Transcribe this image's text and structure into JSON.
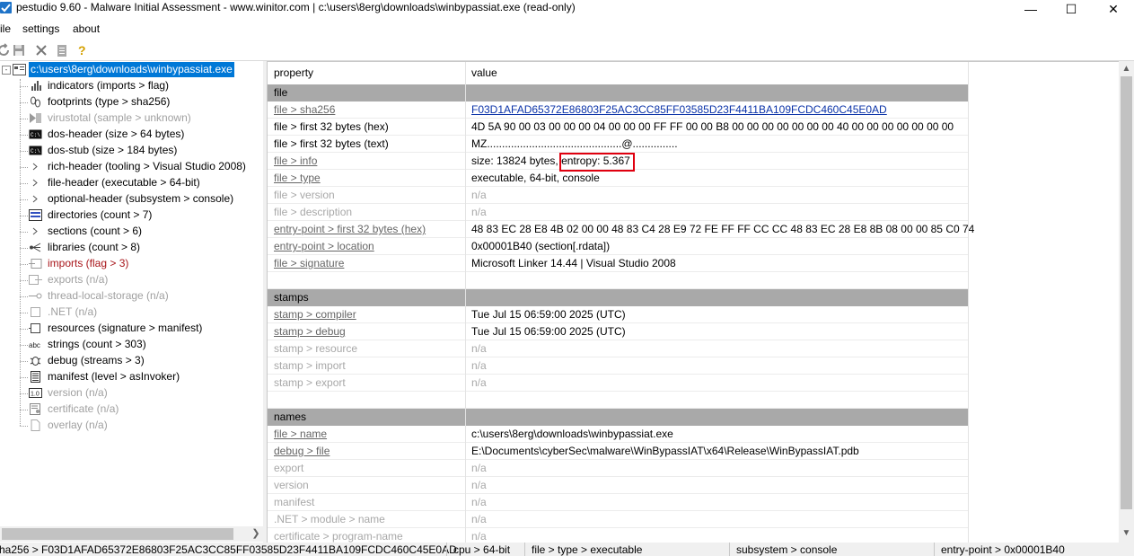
{
  "window": {
    "title": "pestudio 9.60 - Malware Initial Assessment - www.winitor.com | c:\\users\\8erg\\downloads\\winbypassiat.exe (read-only)",
    "minimize": "—",
    "maximize": "☐",
    "close": "✕"
  },
  "menu": {
    "file": "ile",
    "settings": "settings",
    "about": "about"
  },
  "tree": {
    "root": "c:\\users\\8erg\\downloads\\winbypassiat.exe",
    "items": [
      {
        "label": "indicators (imports > flag)",
        "state": "normal"
      },
      {
        "label": "footprints (type > sha256)",
        "state": "normal"
      },
      {
        "label": "virustotal (sample > unknown)",
        "state": "disabled"
      },
      {
        "label": "dos-header (size > 64 bytes)",
        "state": "normal"
      },
      {
        "label": "dos-stub (size > 184 bytes)",
        "state": "normal"
      },
      {
        "label": "rich-header (tooling > Visual Studio 2008)",
        "state": "normal"
      },
      {
        "label": "file-header (executable > 64-bit)",
        "state": "normal"
      },
      {
        "label": "optional-header (subsystem > console)",
        "state": "normal"
      },
      {
        "label": "directories (count > 7)",
        "state": "normal"
      },
      {
        "label": "sections (count > 6)",
        "state": "normal"
      },
      {
        "label": "libraries (count > 8)",
        "state": "normal"
      },
      {
        "label": "imports (flag > 3)",
        "state": "flagged"
      },
      {
        "label": "exports (n/a)",
        "state": "disabled"
      },
      {
        "label": "thread-local-storage (n/a)",
        "state": "disabled"
      },
      {
        "label": ".NET (n/a)",
        "state": "disabled"
      },
      {
        "label": "resources (signature > manifest)",
        "state": "normal"
      },
      {
        "label": "strings (count > 303)",
        "state": "normal"
      },
      {
        "label": "debug (streams > 3)",
        "state": "normal"
      },
      {
        "label": "manifest (level > asInvoker)",
        "state": "normal"
      },
      {
        "label": "version (n/a)",
        "state": "disabled"
      },
      {
        "label": "certificate (n/a)",
        "state": "disabled"
      },
      {
        "label": "overlay (n/a)",
        "state": "disabled"
      }
    ]
  },
  "grid": {
    "header": {
      "property": "property",
      "value": "value"
    },
    "rows": [
      {
        "type": "section",
        "property": "file",
        "value": ""
      },
      {
        "type": "row",
        "property": "file > sha256",
        "value": "F03D1AFAD65372E86803F25AC3CC85FF03585D23F4411BA109FCDC460C45E0AD",
        "plink": true,
        "vlink": true
      },
      {
        "type": "row",
        "property": "file > first 32 bytes (hex)",
        "value": "4D 5A 90 00 03 00 00 00 04 00 00 00 FF FF 00 00 B8 00 00 00 00 00 00 00 40 00 00 00 00 00 00 00"
      },
      {
        "type": "row",
        "property": "file > first 32 bytes (text)",
        "value": "MZ.............................................@..............."
      },
      {
        "type": "row",
        "property": "file > info",
        "value": "size: 13824 bytes, entropy: 5.367",
        "plink": true
      },
      {
        "type": "row",
        "property": "file > type",
        "value": "executable, 64-bit, console",
        "plink": true
      },
      {
        "type": "row",
        "property": "file > version",
        "value": "n/a",
        "disabled": true
      },
      {
        "type": "row",
        "property": "file > description",
        "value": "n/a",
        "disabled": true
      },
      {
        "type": "row",
        "property": "entry-point > first 32 bytes (hex)",
        "value": "48 83 EC 28 E8 4B 02 00 00 48 83 C4 28 E9 72 FE FF FF CC CC 48 83 EC 28 E8 8B 08 00 00 85 C0 74",
        "plink": true
      },
      {
        "type": "row",
        "property": "entry-point > location",
        "value": "0x00001B40 (section[.rdata])",
        "plink": true
      },
      {
        "type": "row",
        "property": "file > signature",
        "value": "Microsoft Linker 14.44 | Visual Studio 2008",
        "plink": true
      },
      {
        "type": "blank",
        "property": "",
        "value": ""
      },
      {
        "type": "section",
        "property": "stamps",
        "value": ""
      },
      {
        "type": "row",
        "property": "stamp > compiler",
        "value": "Tue Jul 15 06:59:00 2025 (UTC)",
        "plink": true
      },
      {
        "type": "row",
        "property": "stamp > debug",
        "value": "Tue Jul 15 06:59:00 2025 (UTC)",
        "plink": true
      },
      {
        "type": "row",
        "property": "stamp > resource",
        "value": "n/a",
        "disabled": true
      },
      {
        "type": "row",
        "property": "stamp > import",
        "value": "n/a",
        "disabled": true
      },
      {
        "type": "row",
        "property": "stamp > export",
        "value": "n/a",
        "disabled": true
      },
      {
        "type": "blank",
        "property": "",
        "value": ""
      },
      {
        "type": "section",
        "property": "names",
        "value": ""
      },
      {
        "type": "row",
        "property": "file > name",
        "value": "c:\\users\\8erg\\downloads\\winbypassiat.exe",
        "plink": true
      },
      {
        "type": "row",
        "property": "debug > file",
        "value": "E:\\Documents\\cyberSec\\malware\\WinBypassIAT\\x64\\Release\\WinBypassIAT.pdb",
        "plink": true
      },
      {
        "type": "row",
        "property": "export",
        "value": "n/a",
        "disabled": true
      },
      {
        "type": "row",
        "property": "version",
        "value": "n/a",
        "disabled": true
      },
      {
        "type": "row",
        "property": "manifest",
        "value": "n/a",
        "disabled": true
      },
      {
        "type": "row",
        "property": ".NET > module > name",
        "value": "n/a",
        "disabled": true
      },
      {
        "type": "row",
        "property": "certificate > program-name",
        "value": "n/a",
        "disabled": true
      }
    ],
    "highlight": "entropy: 5.367"
  },
  "status": {
    "sha": "sha256 > F03D1AFAD65372E86803F25AC3CC85FF03585D23F4411BA109FCDC460C45E0AD",
    "cpu": "cpu > 64-bit",
    "type": "file > type > executable",
    "subsystem": "subsystem > console",
    "entry": "entry-point > 0x00001B40"
  },
  "colors": {
    "selection": "#0078d7",
    "section": "#a9a9a9",
    "highlight_box": "#e0000f",
    "flag": "#a8151a"
  }
}
